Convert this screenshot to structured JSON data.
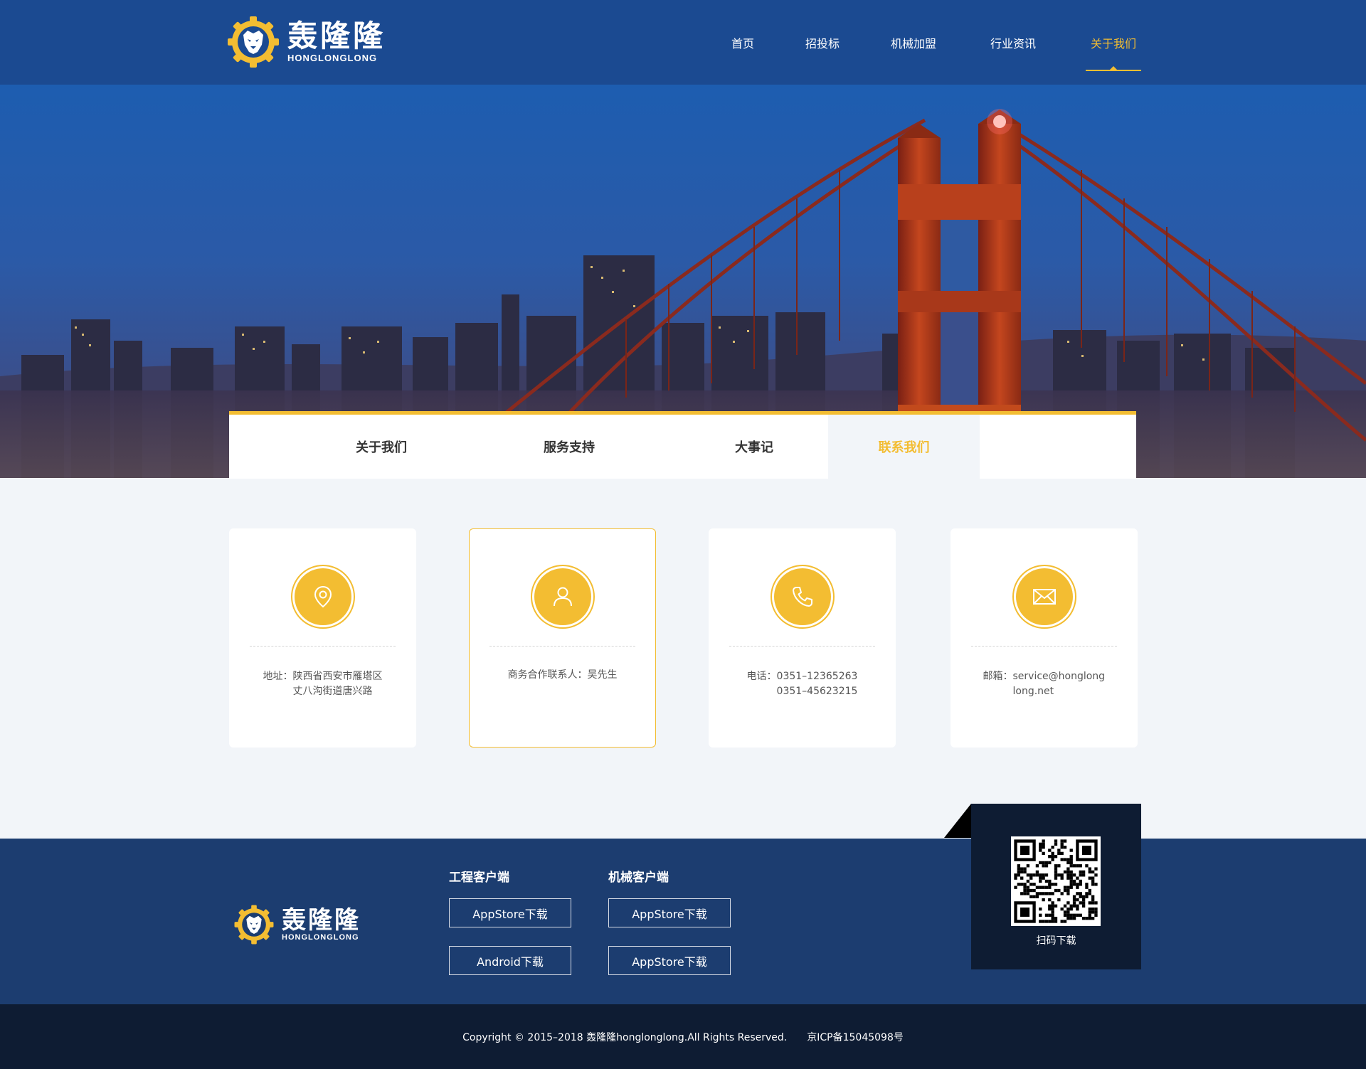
{
  "brand": {
    "name_cn": "轰隆隆",
    "name_en": "HONGLONGLONG"
  },
  "nav": {
    "items": [
      {
        "label": "首页"
      },
      {
        "label": "招投标"
      },
      {
        "label": "机械加盟"
      },
      {
        "label": "行业资讯"
      },
      {
        "label": "关于我们",
        "active": true
      }
    ]
  },
  "subtabs": [
    {
      "label": "关于我们"
    },
    {
      "label": "服务支持"
    },
    {
      "label": "大事记"
    },
    {
      "label": "联系我们",
      "active": true
    }
  ],
  "contacts": [
    {
      "icon": "location-icon",
      "label": "地址：",
      "value": "陕西省西安市雁塔区\n丈八沟街道唐兴路"
    },
    {
      "icon": "person-icon",
      "label": "商务合作联系人：",
      "value": "吴先生"
    },
    {
      "icon": "phone-icon",
      "label": "电话：",
      "value": "0351–12365263\n0351–45623215"
    },
    {
      "icon": "mail-icon",
      "label": "邮箱：",
      "value": "service@honglonglong.net"
    }
  ],
  "footer": {
    "col1": {
      "title": "工程客户端",
      "buttons": [
        "AppStore下载",
        "Android下载"
      ]
    },
    "col2": {
      "title": "机械客户端",
      "buttons": [
        "AppStore下载",
        "AppStore下载"
      ]
    },
    "qr_label": "扫码下载",
    "copyright": "Copyright © 2015–2018 轰隆隆honglonglong.All Rights Reserved.",
    "icp": "京ICP备15045098号"
  },
  "colors": {
    "header": "#1b4a91",
    "accent": "#f3bd32",
    "footer": "#1c3d70",
    "footer_dark": "#0e1c33"
  }
}
